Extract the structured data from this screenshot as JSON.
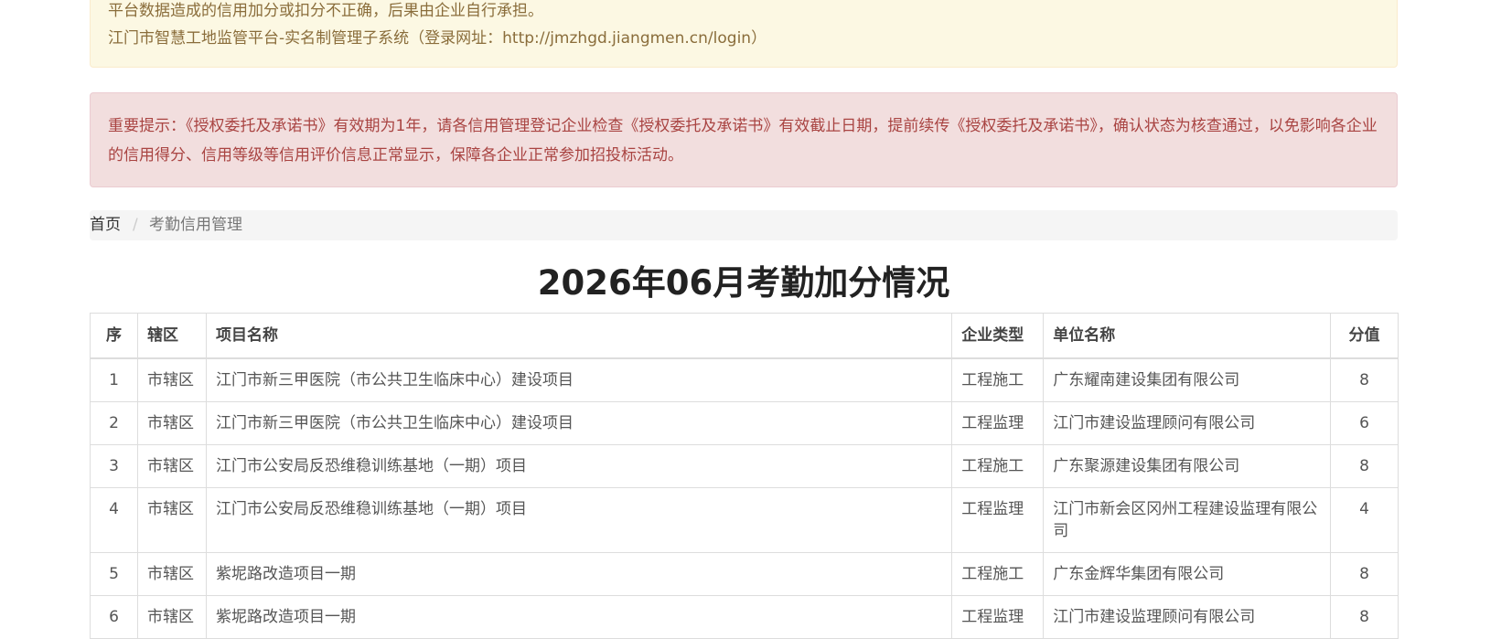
{
  "notices": {
    "warning_line1": "平台数据造成的信用加分或扣分不正确，后果由企业自行承担。",
    "warning_line2": "江门市智慧工地监管平台-实名制管理子系统（登录网址：http://jmzhgd.jiangmen.cn/login）",
    "danger_text": "重要提示：《授权委托及承诺书》有效期为1年，请各信用管理登记企业检查《授权委托及承诺书》有效截止日期，提前续传《授权委托及承诺书》，确认状态为核查通过，以免影响各企业的信用得分、信用等级等信用评价信息正常显示，保障各企业正常参加招投标活动。"
  },
  "breadcrumb": {
    "home": "首页",
    "separator": "/",
    "current": "考勤信用管理"
  },
  "page_title": "2026年06月考勤加分情况",
  "table": {
    "headers": {
      "no": "序",
      "district": "辖区",
      "project": "项目名称",
      "type": "企业类型",
      "company": "单位名称",
      "score": "分值"
    },
    "rows": [
      {
        "no": "1",
        "district": "市辖区",
        "project": "江门市新三甲医院（市公共卫生临床中心）建设项目",
        "type": "工程施工",
        "company": "广东耀南建设集团有限公司",
        "score": "8"
      },
      {
        "no": "2",
        "district": "市辖区",
        "project": "江门市新三甲医院（市公共卫生临床中心）建设项目",
        "type": "工程监理",
        "company": "江门市建设监理顾问有限公司",
        "score": "6"
      },
      {
        "no": "3",
        "district": "市辖区",
        "project": "江门市公安局反恐维稳训练基地（一期）项目",
        "type": "工程施工",
        "company": "广东聚源建设集团有限公司",
        "score": "8"
      },
      {
        "no": "4",
        "district": "市辖区",
        "project": "江门市公安局反恐维稳训练基地（一期）项目",
        "type": "工程监理",
        "company": "江门市新会区冈州工程建设监理有限公司",
        "score": "4"
      },
      {
        "no": "5",
        "district": "市辖区",
        "project": "紫坭路改造项目一期",
        "type": "工程施工",
        "company": "广东金辉华集团有限公司",
        "score": "8"
      },
      {
        "no": "6",
        "district": "市辖区",
        "project": "紫坭路改造项目一期",
        "type": "工程监理",
        "company": "江门市建设监理顾问有限公司",
        "score": "8"
      }
    ]
  }
}
